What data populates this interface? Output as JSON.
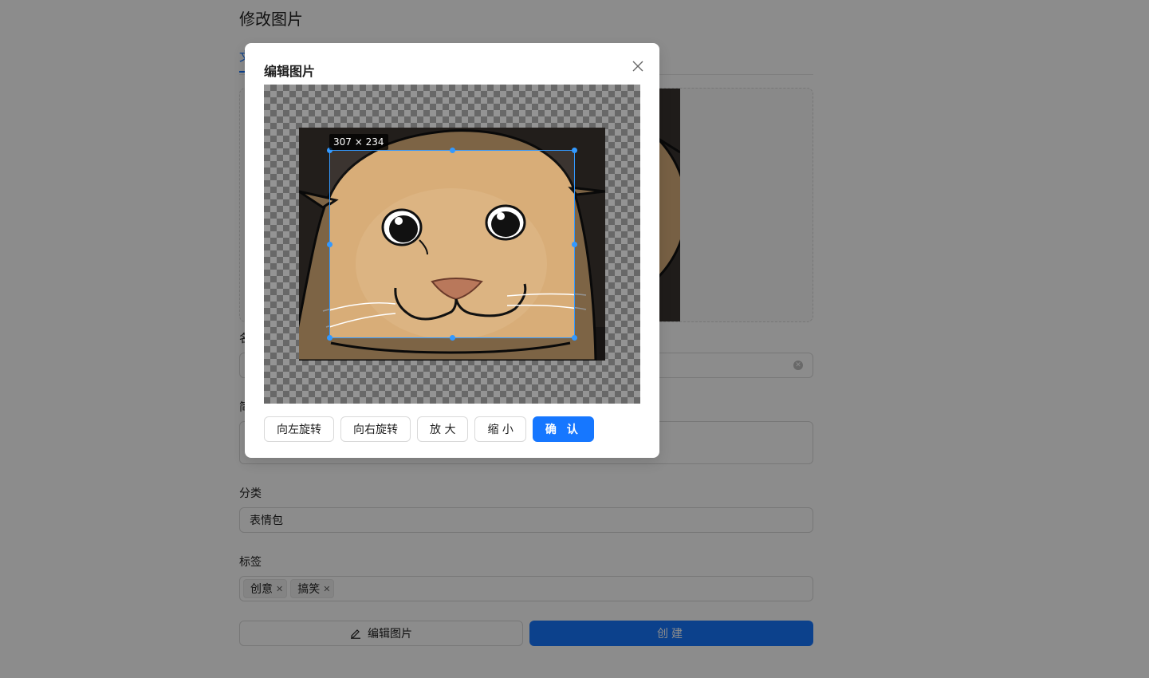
{
  "page": {
    "title": "修改图片",
    "active_tab": "文",
    "fields": {
      "name_label": "名",
      "desc_label": "简",
      "category_label": "分类",
      "category_value": "表情包",
      "tags_label": "标签",
      "tags": [
        "创意",
        "搞笑"
      ]
    },
    "edit_image_button": "编辑图片",
    "create_button": "创建"
  },
  "modal": {
    "title": "编辑图片",
    "crop_size": "307 × 234",
    "buttons": {
      "rotate_left": "向左旋转",
      "rotate_right": "向右旋转",
      "zoom_in": "放 大",
      "zoom_out": "缩 小",
      "confirm": "确 认"
    }
  },
  "colors": {
    "primary": "#1677ff",
    "crop_border": "#3399ff"
  },
  "icons": {
    "close": "close-icon",
    "edit": "pencil-icon",
    "tag_close": "tag-close-icon",
    "clear": "clear-icon"
  }
}
